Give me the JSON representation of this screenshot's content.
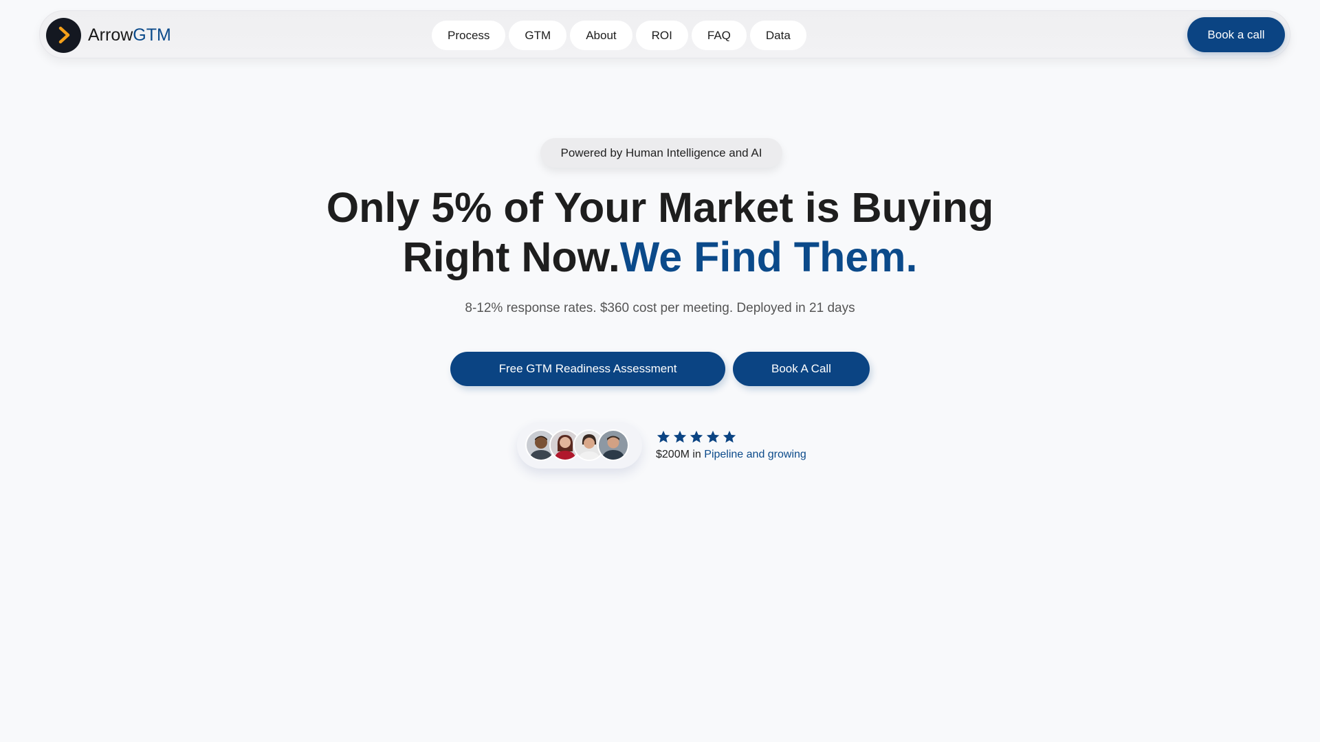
{
  "nav": {
    "brand_prefix": "Arrow",
    "brand_suffix": "GTM",
    "items": [
      {
        "label": "Process"
      },
      {
        "label": "GTM"
      },
      {
        "label": "About"
      },
      {
        "label": "ROI"
      },
      {
        "label": "FAQ"
      },
      {
        "label": "Data"
      }
    ],
    "cta_label": "Book a call",
    "logo_icon": "chevron-right-icon"
  },
  "hero": {
    "badge": "Powered by Human Intelligence and AI",
    "headline_line1": "Only 5% of Your Market is Buying",
    "headline_line2_dark": "Right Now.",
    "headline_line2_blue": "We Find Them.",
    "subline": "8-12% response rates. $360 cost per meeting. Deployed in 21 days",
    "cta_primary": "Free GTM Readiness Assessment",
    "cta_secondary": "Book A Call"
  },
  "social_proof": {
    "rating": 5,
    "avatars": [
      "avatar-man-1",
      "avatar-woman-1",
      "avatar-woman-2",
      "avatar-man-2"
    ],
    "pipeline_amount": "$200M in ",
    "pipeline_highlight": "Pipeline and growing"
  },
  "colors": {
    "brand_blue": "#0b4483",
    "accent_orange": "#f5a01a",
    "background": "#f8f9fb"
  }
}
